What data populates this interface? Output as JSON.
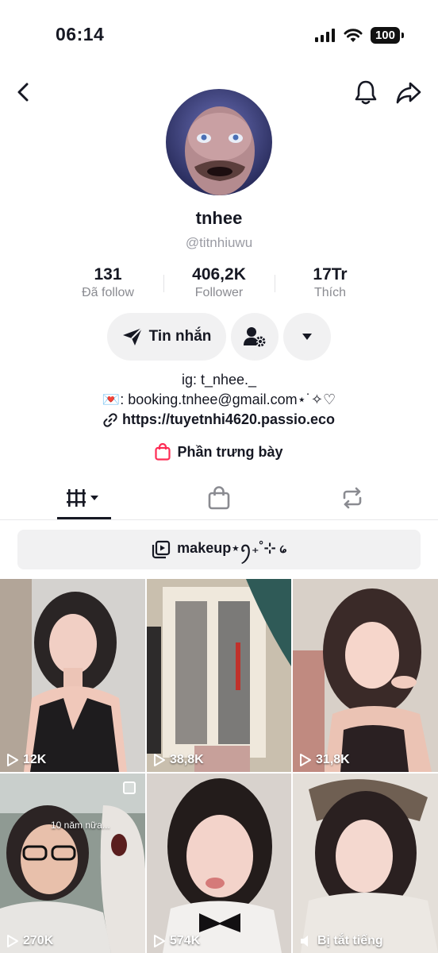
{
  "status": {
    "time": "06:14",
    "battery": "100"
  },
  "profile": {
    "display_name": "tnhee",
    "handle": "@titnhiuwu",
    "stats": [
      {
        "value": "131",
        "label": "Đã follow"
      },
      {
        "value": "406,2K",
        "label": "Follower"
      },
      {
        "value": "17Tr",
        "label": "Thích"
      }
    ]
  },
  "actions": {
    "message_label": "Tin nhắn"
  },
  "bio": {
    "line1": "ig: t_nhee._",
    "line2": "💌: booking.tnhee@gmail.com⋆˙✧♡",
    "link": "https://tuyetnhi4620.passio.eco"
  },
  "showcase": {
    "label": "Phần trưng bày"
  },
  "playlist": {
    "label": "makeup⋆ꪆ₊˚⊹ ᥀"
  },
  "videos": [
    {
      "views": "12K"
    },
    {
      "views": "38,8K"
    },
    {
      "views": "31,8K"
    },
    {
      "views": "270K",
      "caption": "10 năm nữa..."
    },
    {
      "views": "574K"
    },
    {
      "views": "Bị tắt tiếng"
    }
  ],
  "colors": {
    "accent": "#fe2c55",
    "text": "#161823",
    "secondary": "#8a8b91"
  }
}
